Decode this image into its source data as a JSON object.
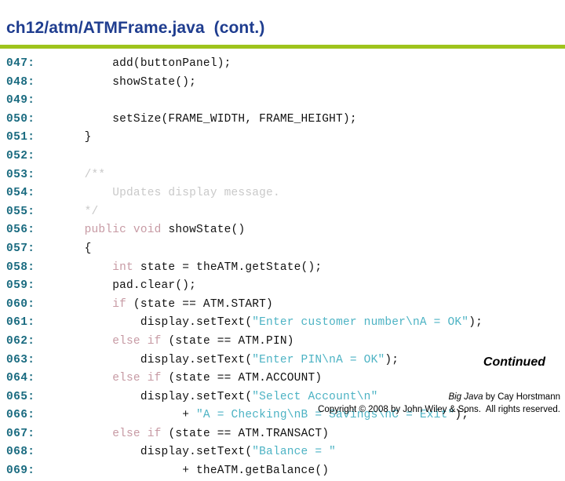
{
  "header": {
    "title": "ch12/atm/ATMFrame.java  (cont.)",
    "rule_color": "#9ec41c",
    "title_color": "#1f3d8f"
  },
  "colors": {
    "line_number": "#1a6b80",
    "code": "#111111",
    "keyword": "#c79aa4",
    "string": "#4db3c4",
    "comment": "#c9c9c9"
  },
  "code": {
    "lines": [
      {
        "n": "047:",
        "tokens": [
          {
            "t": "plain",
            "s": "        add(buttonPanel);"
          }
        ]
      },
      {
        "n": "048:",
        "tokens": [
          {
            "t": "plain",
            "s": "        showState();"
          }
        ]
      },
      {
        "n": "049:",
        "tokens": [
          {
            "t": "plain",
            "s": ""
          }
        ]
      },
      {
        "n": "050:",
        "tokens": [
          {
            "t": "plain",
            "s": "        setSize(FRAME_WIDTH, FRAME_HEIGHT);"
          }
        ]
      },
      {
        "n": "051:",
        "tokens": [
          {
            "t": "plain",
            "s": "    }"
          }
        ]
      },
      {
        "n": "052:",
        "tokens": [
          {
            "t": "plain",
            "s": ""
          }
        ]
      },
      {
        "n": "053:",
        "tokens": [
          {
            "t": "com",
            "s": "    /**"
          }
        ]
      },
      {
        "n": "054:",
        "tokens": [
          {
            "t": "com",
            "s": "        Updates display message."
          }
        ]
      },
      {
        "n": "055:",
        "tokens": [
          {
            "t": "com",
            "s": "    */"
          }
        ]
      },
      {
        "n": "056:",
        "tokens": [
          {
            "t": "kw",
            "s": "    public void "
          },
          {
            "t": "plain",
            "s": "showState()"
          }
        ]
      },
      {
        "n": "057:",
        "tokens": [
          {
            "t": "plain",
            "s": "    {"
          }
        ]
      },
      {
        "n": "058:",
        "tokens": [
          {
            "t": "kw",
            "s": "        int "
          },
          {
            "t": "plain",
            "s": "state = theATM.getState();"
          }
        ]
      },
      {
        "n": "059:",
        "tokens": [
          {
            "t": "plain",
            "s": "        pad.clear();"
          }
        ]
      },
      {
        "n": "060:",
        "tokens": [
          {
            "t": "kw",
            "s": "        if "
          },
          {
            "t": "plain",
            "s": "(state == ATM.START)"
          }
        ]
      },
      {
        "n": "061:",
        "tokens": [
          {
            "t": "plain",
            "s": "            display.setText("
          },
          {
            "t": "str",
            "s": "\"Enter customer number\\nA = OK\""
          },
          {
            "t": "plain",
            "s": ");"
          }
        ]
      },
      {
        "n": "062:",
        "tokens": [
          {
            "t": "kw",
            "s": "        else if "
          },
          {
            "t": "plain",
            "s": "(state == ATM.PIN)"
          }
        ]
      },
      {
        "n": "063:",
        "tokens": [
          {
            "t": "plain",
            "s": "            display.setText("
          },
          {
            "t": "str",
            "s": "\"Enter PIN\\nA = OK\""
          },
          {
            "t": "plain",
            "s": ");"
          }
        ]
      },
      {
        "n": "064:",
        "tokens": [
          {
            "t": "kw",
            "s": "        else if "
          },
          {
            "t": "plain",
            "s": "(state == ATM.ACCOUNT)"
          }
        ]
      },
      {
        "n": "065:",
        "tokens": [
          {
            "t": "plain",
            "s": "            display.setText("
          },
          {
            "t": "str",
            "s": "\"Select Account\\n\""
          }
        ]
      },
      {
        "n": "066:",
        "tokens": [
          {
            "t": "plain",
            "s": "                  + "
          },
          {
            "t": "str",
            "s": "\"A = Checking\\nB = Savings\\nC = Exit\""
          },
          {
            "t": "plain",
            "s": ");"
          }
        ]
      },
      {
        "n": "067:",
        "tokens": [
          {
            "t": "kw",
            "s": "        else if "
          },
          {
            "t": "plain",
            "s": "(state == ATM.TRANSACT)"
          }
        ]
      },
      {
        "n": "068:",
        "tokens": [
          {
            "t": "plain",
            "s": "            display.setText("
          },
          {
            "t": "str",
            "s": "\"Balance = \""
          }
        ]
      },
      {
        "n": "069:",
        "tokens": [
          {
            "t": "plain",
            "s": "                  + theATM.getBalance()"
          }
        ]
      }
    ]
  },
  "footer": {
    "continued": "Continued",
    "credit_book": "Big Java",
    "credit_rest": " by Cay Horstmann",
    "copyright": "Copyright © 2008 by John Wiley & Sons.  All rights reserved."
  }
}
